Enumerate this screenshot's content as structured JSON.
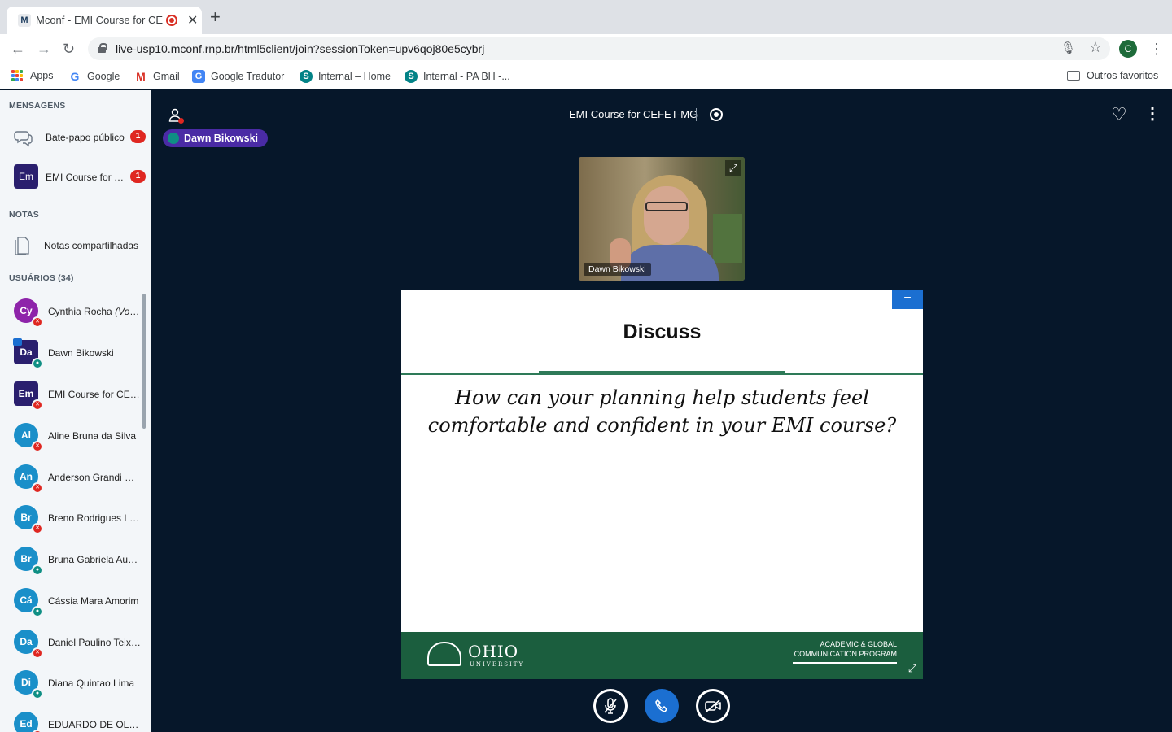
{
  "browser": {
    "tab_title": "Mconf - EMI Course for CEFET-MG",
    "tab_favicon": "M",
    "url": "live-usp10.mconf.rnp.br/html5client/join?sessionToken=upv6qoj80e5cybrj",
    "profile_initial": "C",
    "bookmarks": [
      {
        "label": "Apps",
        "icon": "apps-grid-icon"
      },
      {
        "label": "Google",
        "icon": "google-icon"
      },
      {
        "label": "Gmail",
        "icon": "gmail-icon"
      },
      {
        "label": "Google Tradutor",
        "icon": "translate-icon"
      },
      {
        "label": "Internal – Home",
        "icon": "sharepoint-icon"
      },
      {
        "label": "Internal - PA BH -...",
        "icon": "sharepoint-icon"
      }
    ],
    "other_bookmarks": "Outros favoritos"
  },
  "sidebar": {
    "messages_title": "MENSAGENS",
    "public_chat": {
      "label": "Bate-papo público",
      "badge": "1"
    },
    "private_chat": {
      "avatar": "Em",
      "label": "EMI Course for CEFET-MG",
      "badge": "1"
    },
    "notes_title": "NOTAS",
    "shared_notes": "Notas compartilhadas",
    "users_title": "USUÁRIOS (34)",
    "users": [
      {
        "initials": "Cy",
        "name": "Cynthia Rocha",
        "suffix": "(Você)",
        "color": "#8e24aa",
        "status": "muted"
      },
      {
        "initials": "Da",
        "name": "Dawn Bikowski",
        "color": "#2a1f6e",
        "status": "listen",
        "presenter": true
      },
      {
        "initials": "Em",
        "name": "EMI Course for CEFET-MG",
        "color": "#2a1f6e",
        "status": "muted"
      },
      {
        "initials": "Al",
        "name": "Aline Bruna da Silva",
        "color": "#1a8fc9",
        "status": "muted"
      },
      {
        "initials": "An",
        "name": "Anderson Grandi Pires",
        "color": "#1a8fc9",
        "status": "muted"
      },
      {
        "initials": "Br",
        "name": "Breno Rodrigues Lacerda",
        "color": "#1a8fc9",
        "status": "muted"
      },
      {
        "initials": "Br",
        "name": "Bruna Gabriela Augusto",
        "color": "#1a8fc9",
        "status": "listen"
      },
      {
        "initials": "Cá",
        "name": "Cássia Mara Amorim",
        "color": "#1a8fc9",
        "status": "listen"
      },
      {
        "initials": "Da",
        "name": "Daniel Paulino Teixeira",
        "color": "#1a8fc9",
        "status": "muted"
      },
      {
        "initials": "Di",
        "name": "Diana Quintao Lima",
        "color": "#1a8fc9",
        "status": "listen"
      },
      {
        "initials": "Ed",
        "name": "EDUARDO DE OLIVEIRA",
        "color": "#1a8fc9",
        "status": "muted"
      }
    ]
  },
  "main": {
    "meeting_title": "EMI Course for CEFET-MG",
    "talker": "Dawn Bikowski",
    "video_name": "Dawn Bikowski",
    "slide": {
      "title": "Discuss",
      "question": "How can your planning help students feel comfortable and confident in your EMI course?",
      "footer_university": "OHIO",
      "footer_university_sub": "UNIVERSITY",
      "footer_program_line1": "ACADEMIC & GLOBAL",
      "footer_program_line2": "COMMUNICATION PROGRAM"
    }
  },
  "colors": {
    "main_bg": "#06172a",
    "accent": "#1b6fd1",
    "muted_badge": "#df2721",
    "listen_badge": "#0f8f84",
    "talker_bg": "#4a2ba5",
    "ohio_green": "#1b5e3e"
  }
}
